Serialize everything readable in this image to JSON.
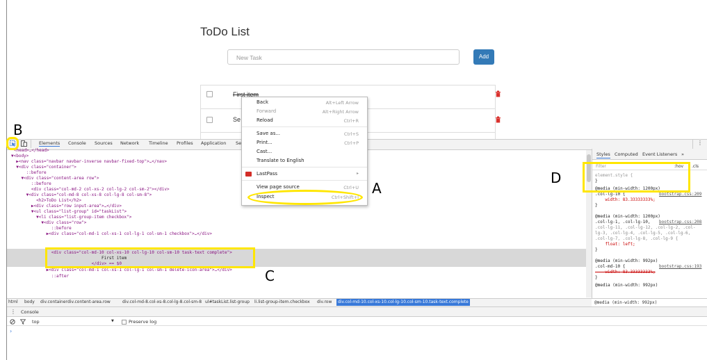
{
  "page": {
    "title": "ToDo List",
    "input_placeholder": "New Task",
    "add_label": "Add",
    "items": [
      "First item",
      "Se"
    ]
  },
  "devtools": {
    "tabs": [
      "Elements",
      "Console",
      "Sources",
      "Network",
      "Timeline",
      "Profiles",
      "Application",
      "Se"
    ],
    "menu_icon": "⋮",
    "dom_lines": {
      "l0": "<head>…</head>",
      "l1": "▼<body>",
      "l2": "  ▶<nav class=\"navbar navbar-inverse navbar-fixed-top\">…</nav>",
      "l3": "  ▼<div class=\"container\">",
      "l4": "      ::before",
      "l5": "    ▼<div class=\"content-area row\">",
      "l6": "        ::before",
      "l7": "        <div class=\"col-md-2 col-xs-2 col-lg-2 col-sm-2\"></div>",
      "l8": "      ▼<div class=\"col-md-8 col-xs-8 col-lg-8 col-sm-8\">",
      "l9": "          <h2>ToDo List</h2>",
      "l10": "        ▶<div class=\"row input-area\">…</div>",
      "l11": "        ▼<ul class=\"list-group\" id=\"taskList\">",
      "l12": "          ▼<li class=\"list-group-item checkbox\">",
      "l13": "            ▼<div class=\"row\">",
      "l14": "                ::before",
      "l15": "              ▶<div class=\"col-md-1 col-xs-1 col-lg-1 col-sm-1 checkbox\">…</div>",
      "l16": "                <div class=\"col-md-10 col-xs-10 col-lg-10 col-sm-10 task-text complete\">",
      "l17": "                                    First item",
      "l18": "                                </div> == $0",
      "l19": "              ▶<div class=\"col-md-1 col-xs-1 col-lg-1 col-sm-1 delete-icon-area\">…</div>",
      "l20": "                ::after"
    },
    "styles_tabs": [
      "Styles",
      "Computed",
      "Event Listeners",
      "»"
    ],
    "styles_filter": "Filter",
    "styles_hov": ":hov",
    "styles_cls": ".cls",
    "styles_lines": {
      "s0": "element.style {",
      "s1": "}",
      "s2": "@media (min-width: 1200px)",
      "s3": ".col-lg-10 {",
      "s3link": "bootstrap.css:209",
      "s4": "    width: 83.33333333%;",
      "s5": "}",
      "s6": "@media (min-width: 1200px)",
      "s7": ".col-lg-1, .col-lg-10,",
      "s7link": "bootstrap.css:208",
      "s8": ".col-lg-11, .col-lg-12, .col-lg-2, .col-",
      "s9": "lg-3, .col-lg-4, .col-lg-5, .col-lg-6,",
      "s10": ".col-lg-7, .col-lg-8, .col-lg-9 {",
      "s11": "    float: left;",
      "s12": "}",
      "s13": "@media (min-width: 992px)",
      "s14": ".col-md-10 {",
      "s14link": "bootstrap.css:193",
      "s15": "    width: 83.33333333%;",
      "s16": "}",
      "s17": "@media (min-width: 992px)"
    },
    "breadcrumbs": [
      "html",
      "body",
      "div.container",
      "div.content-area.row",
      "div.col-md-8.col-xs-8.col-lg-8.col-sm-8",
      "ul#taskList.list-group",
      "li.list-group-item.checkbox",
      "div.row",
      "div.col-md-10.col-xs-10.col-lg-10.col-sm-10.task-text.complete"
    ],
    "console_tab": "Console",
    "console_context": "top",
    "preserve_log": "Preserve log",
    "prompt": "›"
  },
  "context_menu": {
    "items": [
      {
        "label": "Back",
        "shortcut": "Alt+Left Arrow"
      },
      {
        "label": "Forward",
        "shortcut": "Alt+Right Arrow"
      },
      {
        "label": "Reload",
        "shortcut": "Ctrl+R"
      },
      {
        "label": "Save as...",
        "shortcut": "Ctrl+S"
      },
      {
        "label": "Print...",
        "shortcut": "Ctrl+P"
      },
      {
        "label": "Cast..."
      },
      {
        "label": "Translate to English"
      },
      {
        "label": "LastPass"
      },
      {
        "label": "View page source",
        "shortcut": "Ctrl+U"
      },
      {
        "label": "Inspect",
        "shortcut": "Ctrl+Shift+I"
      }
    ]
  },
  "annotations": {
    "a": "A",
    "b": "B",
    "c": "C",
    "d": "D"
  },
  "colors": {
    "accent": "#3879d9",
    "highlight": "#ffe600",
    "add_button": "#337ab7",
    "trash": "#d9302c"
  },
  "icons": [
    "inspect-element-icon",
    "device-toolbar-icon",
    "trash-icon",
    "lastpass-icon",
    "clear-console-icon",
    "filter-icon"
  ]
}
